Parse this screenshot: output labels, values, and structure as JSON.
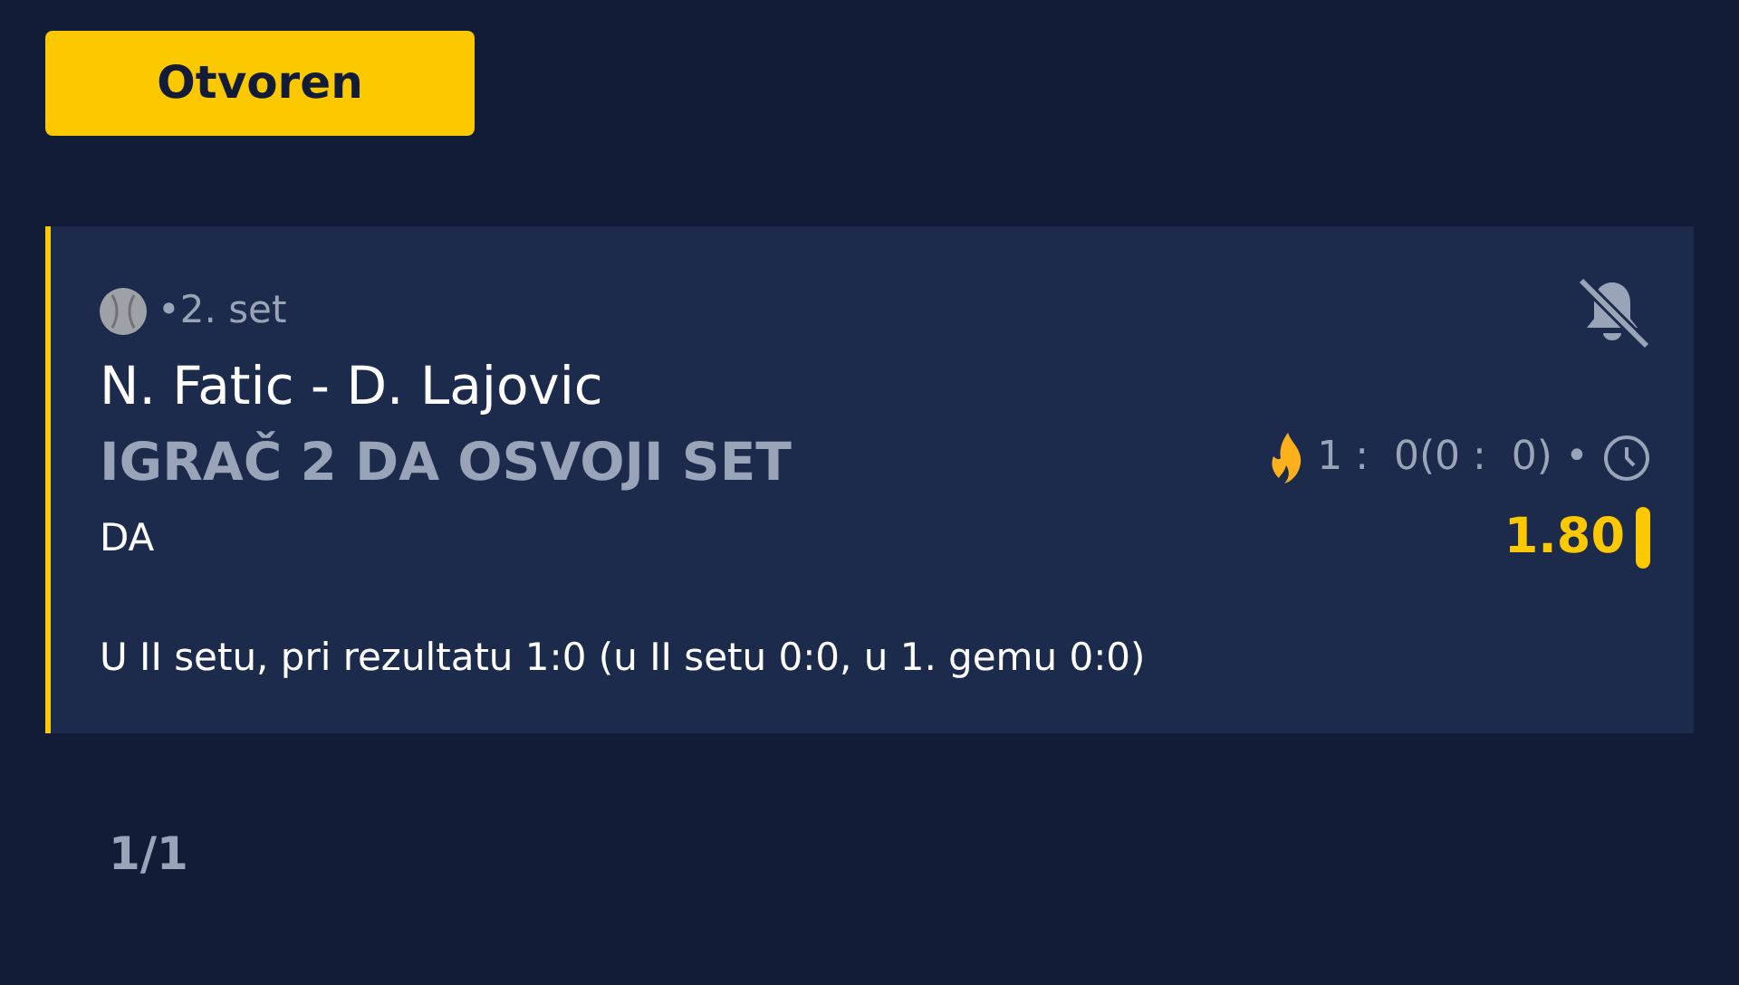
{
  "status_badge": {
    "label": "Otvoren"
  },
  "bet": {
    "period": "•2. set",
    "match": "N. Fatic - D. Lajovic",
    "market": "IGRAČ 2 DA OSVOJI SET",
    "pick": "DA",
    "score": "1 :  0(0 :  0) •",
    "odds": "1.80",
    "live": true,
    "notifications_muted": true,
    "description": "U II setu, pri rezultatu 1:0 (u II setu 0:0, u 1. gemu 0:0)"
  },
  "pagination": "1/1"
}
